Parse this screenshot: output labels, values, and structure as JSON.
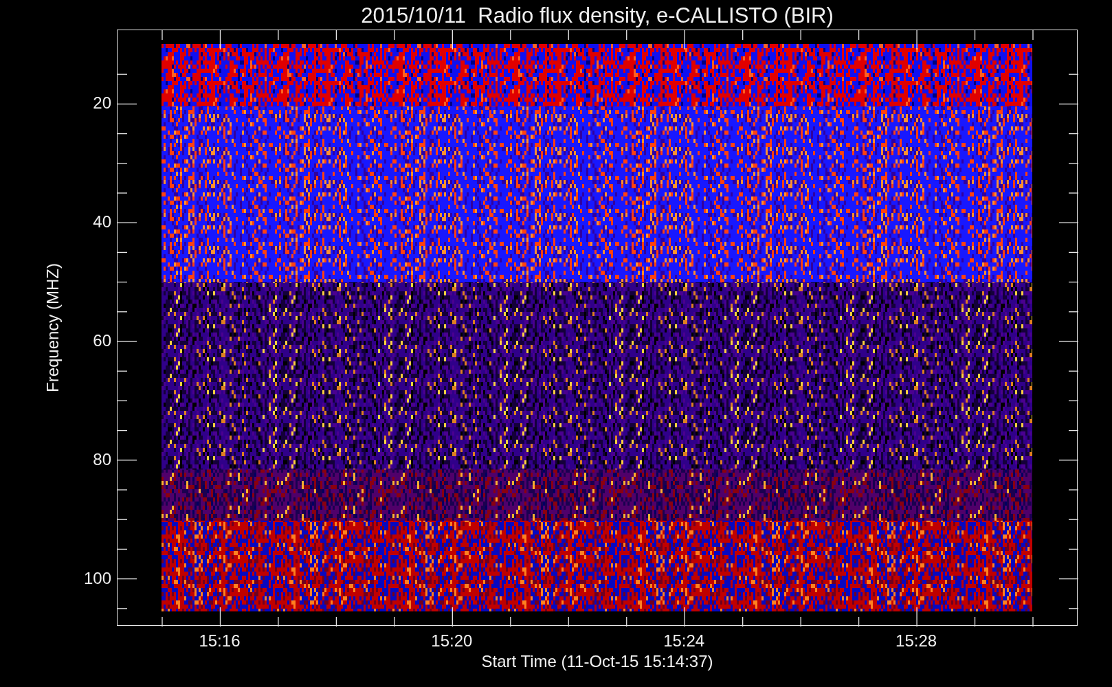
{
  "title": "2015/10/11  Radio flux density, e-CALLISTO (BIR)",
  "y_axis": {
    "label": "Frequency (MHZ)",
    "ticks": [
      "20",
      "40",
      "60",
      "80",
      "100"
    ]
  },
  "x_axis": {
    "label": "Start Time (11-Oct-15 15:14:37)",
    "ticks": [
      "15:16",
      "15:20",
      "15:24",
      "15:28"
    ]
  }
}
